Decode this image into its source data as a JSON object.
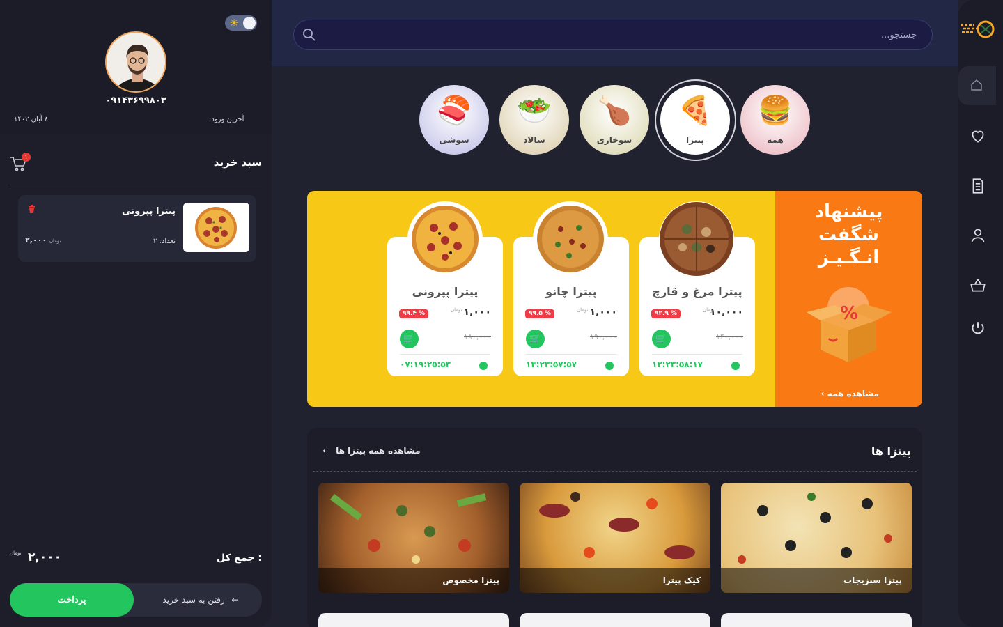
{
  "theme": {
    "accent": "#22c55e",
    "promo_yellow": "#f7c816",
    "promo_orange": "#f97915",
    "discount_red": "#ef3b45"
  },
  "user": {
    "phone": "۰۹۱۴۳۶۹۹۸۰۳",
    "last_login_label": "آخرین ورود:",
    "last_login_date": "۸ آبان ۱۴۰۲"
  },
  "cart": {
    "title": "سبد خرید",
    "badge": "۱",
    "items": [
      {
        "name": "پیتزا پپرونی",
        "qty": "تعداد: ۲",
        "price": "۲,۰۰۰",
        "currency": "تومان"
      }
    ],
    "total_label": "جمع کل :",
    "total_value": "۲,۰۰۰",
    "total_currency": "تومان",
    "pay_label": "پرداخت",
    "go_cart_label": "رفتن به سبد خرید"
  },
  "search": {
    "placeholder": "جستجو..."
  },
  "categories": [
    {
      "label": "همه",
      "icon": "fast-food-icon"
    },
    {
      "label": "پیتزا",
      "icon": "pizza-icon",
      "selected": true
    },
    {
      "label": "سوخاری",
      "icon": "drumstick-icon"
    },
    {
      "label": "سالاد",
      "icon": "salad-icon"
    },
    {
      "label": "سوشی",
      "icon": "sushi-icon"
    }
  ],
  "promo": {
    "title_lines": [
      "پیشنهاد",
      "شگفت",
      "انـگـیـز"
    ],
    "view_all": "مشاهده همه",
    "cards": [
      {
        "name": "پیتزا مرغ و قارچ",
        "price": "۱۰,۰۰۰",
        "currency": "تومان",
        "old_price": "۱۴۰,۰۰۰",
        "discount": "۹۲.۹ %",
        "timer": "۱۳:۲۳:۵۸:۱۷"
      },
      {
        "name": "پیتزا چانو",
        "price": "۱,۰۰۰",
        "currency": "تومان",
        "old_price": "۱۹۰,۰۰۰",
        "discount": "۹۹.۵ %",
        "timer": "۱۴:۲۳:۵۷:۵۷"
      },
      {
        "name": "پیتزا پپرونی",
        "price": "۱,۰۰۰",
        "currency": "تومان",
        "old_price": "۱۸۰,۰۰۰",
        "discount": "۹۹.۴ %",
        "timer": "۰۷:۱۹:۲۵:۵۳"
      }
    ]
  },
  "pizzas": {
    "title": "پیتزا ها",
    "view_all": "مشاهده همه پیتزا ها",
    "items": [
      {
        "label": "پیتزا سبزیجات"
      },
      {
        "label": "کیک پیتزا"
      },
      {
        "label": "پیتزا مخصوص"
      }
    ]
  },
  "nav_icons": [
    "home-icon",
    "heart-icon",
    "document-icon",
    "user-icon",
    "basket-icon",
    "power-icon"
  ]
}
